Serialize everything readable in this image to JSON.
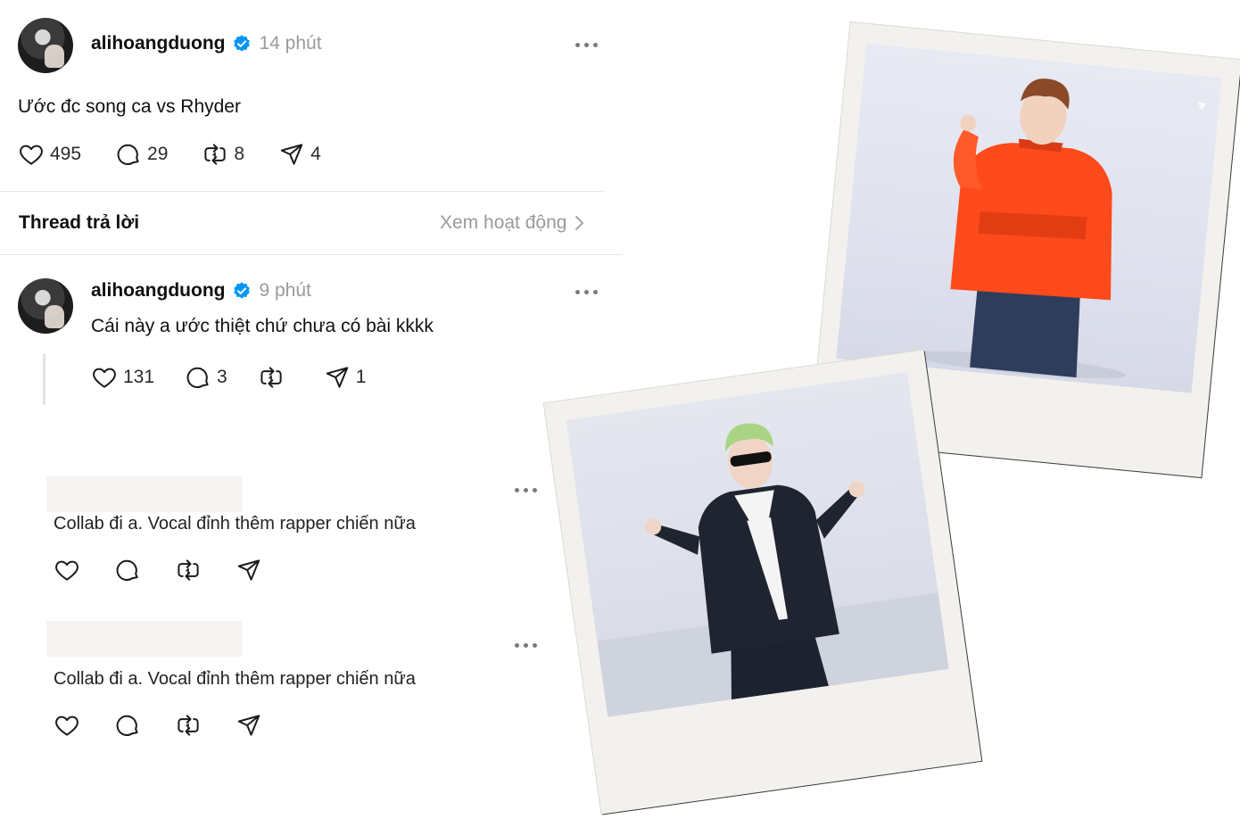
{
  "post": {
    "username": "alihoangduong",
    "time": "14 phút",
    "text": "Ước đc song ca vs Rhyder",
    "stats": {
      "likes": "495",
      "comments": "29",
      "reposts": "8",
      "shares": "4"
    }
  },
  "section": {
    "title": "Thread trả lời",
    "see_activity": "Xem hoạt động"
  },
  "reply": {
    "username": "alihoangduong",
    "time": "9 phút",
    "text": "Cái này a ước thiệt chứ chưa có bài kkkk",
    "stats": {
      "likes": "131",
      "comments": "3",
      "shares": "1"
    }
  },
  "comments": [
    {
      "text": "Collab đi a. Vocal đỉnh thêm rapper chiến nữa"
    },
    {
      "text": "Collab đi a. Vocal đỉnh thêm rapper chiến nữa"
    }
  ],
  "colors": {
    "verified": "#0095f6",
    "jacket": "#ff4a1c",
    "frame": "#f2f1ed"
  },
  "icons": [
    "heart-icon",
    "comment-icon",
    "repost-icon",
    "share-icon",
    "more-icon",
    "verified-badge-icon",
    "chevron-right-icon"
  ]
}
